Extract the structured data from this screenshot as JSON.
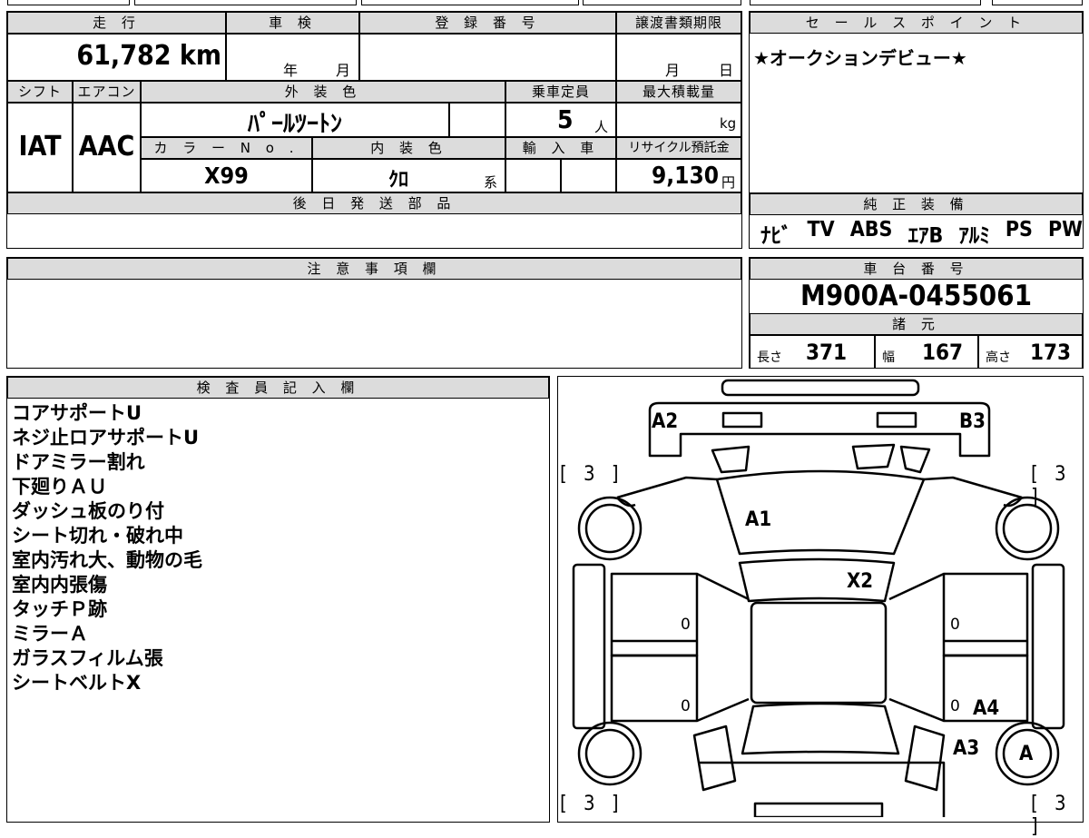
{
  "headers": {
    "mileage": "走 行",
    "shaken": "車 検",
    "registration": "登 録 番 号",
    "transfer_deadline": "譲渡書類期限",
    "sales_point": "セ ー ル ス ポ イ ン ト",
    "shift": "シフト",
    "aircon": "エアコン",
    "exterior_color": "外 装 色",
    "capacity": "乗車定員",
    "max_load": "最大積載量",
    "color_no": "カ ラ ー N o .",
    "interior_color": "内 装 色",
    "import": "輸 入 車",
    "recycle": "リサイクル預託金",
    "later_parts": "後 日 発 送 部 品",
    "genuine_equipment": "純 正 装 備",
    "cautions": "注 意 事 項 欄",
    "chassis_number": "車 台 番 号",
    "specs": "諸 元",
    "inspector": "検 査 員 記 入 欄"
  },
  "values": {
    "mileage": "61,782",
    "mileage_unit": "km",
    "shaken_year": "年",
    "shaken_month": "月",
    "deadline_month": "月",
    "deadline_day": "日",
    "shift": "IAT",
    "aircon": "AAC",
    "exterior_color": "ﾊﾟｰﾙﾂｰﾄﾝ",
    "capacity": "5",
    "capacity_unit": "人",
    "max_load_unit": "kg",
    "color_no": "X99",
    "interior_color": "ｸﾛ",
    "interior_suffix": "系",
    "recycle_fee": "9,130",
    "recycle_unit": "円",
    "sales_point_text": "★オークションデビュー★",
    "genuine_equipment": [
      "ﾅﾋﾞ",
      "TV",
      "ABS",
      "ｴｱB",
      "ｱﾙﾐ",
      "PS",
      "PW"
    ],
    "chassis_number": "M900A-0455061",
    "length_label": "長さ",
    "length": "371",
    "width_label": "幅",
    "width": "167",
    "height_label": "高さ",
    "height": "173"
  },
  "inspector_notes": [
    "コアサポートU",
    "ネジ止ロアサポートU",
    "ドアミラー割れ",
    "下廻りＡＵ",
    "ダッシュ板のり付",
    "シート切れ・破れ中",
    "室内汚れ大、動物の毛",
    "室内内張傷",
    "タッチＰ跡",
    "ミラーＡ",
    "ガラスフィルム張",
    "シートベルトX"
  ],
  "diagram": {
    "tire_fl": "[ 3 ]",
    "tire_fr": "[ 3 ]",
    "tire_rl": "[ 3 ]",
    "tire_rr": "[ 3 ]",
    "a2": "A2",
    "b3": "B3",
    "a1": "A1",
    "x2": "X2",
    "a4": "A4",
    "a3": "A3",
    "a": "A",
    "zero": "0"
  }
}
